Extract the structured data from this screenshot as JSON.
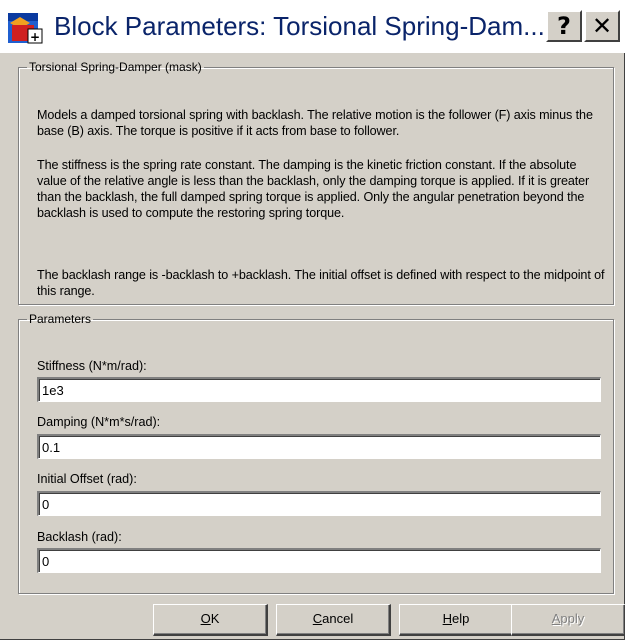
{
  "window": {
    "title": "Block Parameters: Torsional  Spring-Dam...",
    "help_glyph": "?",
    "close_glyph": "✕"
  },
  "description": {
    "legend": "Torsional Spring-Damper (mask)",
    "paragraphs": [
      "Models a damped torsional spring with backlash.  The relative motion is the follower (F) axis minus the base (B) axis. The torque is positive if it acts from base to follower.",
      "The stiffness is the spring rate constant. The damping is the kinetic friction constant. If the absolute value of the relative angle is less than the backlash, only the damping torque is applied. If it is greater than the backlash, the full damped spring torque is applied. Only the angular penetration beyond the backlash is used to compute the restoring spring torque.",
      "The backlash range is -backlash to +backlash. The initial offset is defined with respect to the midpoint of this range."
    ]
  },
  "parameters": {
    "legend": "Parameters",
    "fields": [
      {
        "label": "Stiffness (N*m/rad):",
        "value": "1e3"
      },
      {
        "label": "Damping (N*m*s/rad):",
        "value": "0.1"
      },
      {
        "label": "Initial Offset (rad):",
        "value": "0"
      },
      {
        "label": "Backlash (rad):",
        "value": "0"
      }
    ]
  },
  "buttons": {
    "ok": {
      "accel": "O",
      "rest": "K"
    },
    "cancel": {
      "accel": "C",
      "rest": "ancel"
    },
    "help": {
      "accel": "H",
      "rest": "elp"
    },
    "apply": {
      "accel": "A",
      "rest": "pply"
    }
  },
  "colors": {
    "title_text": "#0a246a",
    "dialog_face": "#d4d0c8"
  },
  "icons": [
    "simulink-block-icon",
    "help-icon",
    "close-icon"
  ]
}
